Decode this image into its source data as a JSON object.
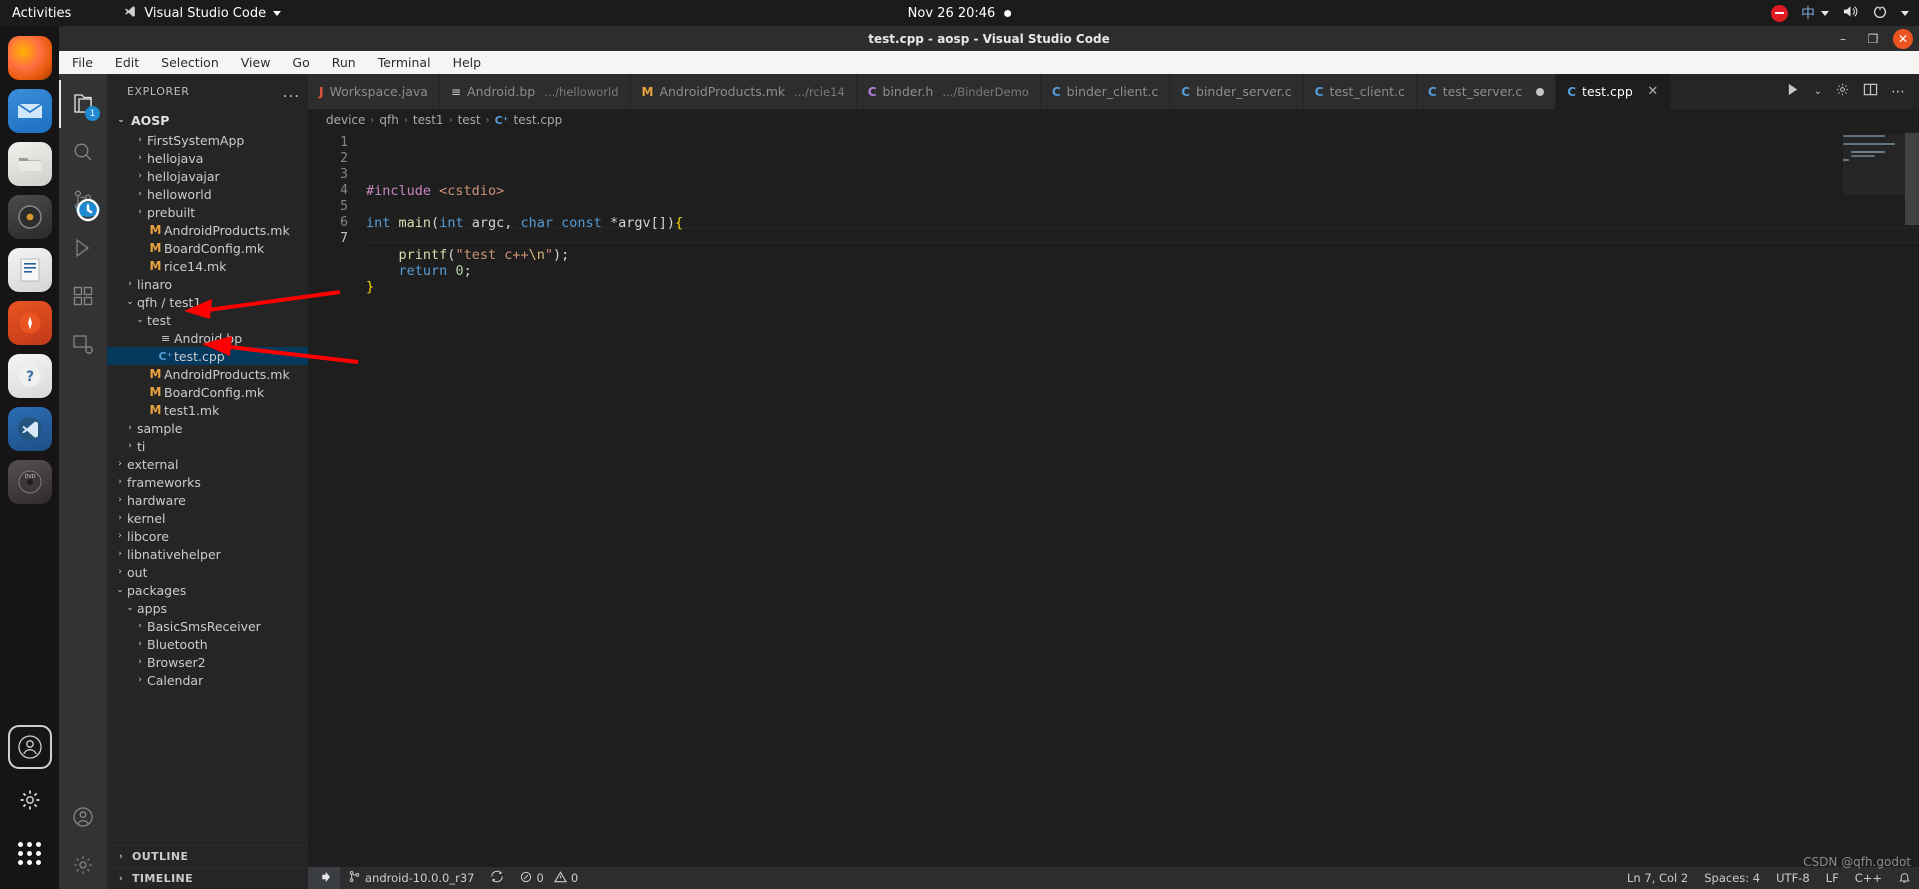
{
  "gnome": {
    "activities": "Activities",
    "app_name": "Visual Studio Code",
    "app_icon": "vscode-icon",
    "clock": "Nov 26  20:46",
    "notification_dot": "notification-dot",
    "record_icon": "record-stop-icon",
    "ime_label": "中",
    "volume_icon": "volume-icon",
    "power_icon": "power-icon"
  },
  "dock": {
    "items": [
      {
        "name": "firefox",
        "glyph": ""
      },
      {
        "name": "thunderbird",
        "glyph": ""
      },
      {
        "name": "files",
        "glyph": ""
      },
      {
        "name": "rhythmbox",
        "glyph": ""
      },
      {
        "name": "libreoffice-writer",
        "glyph": ""
      },
      {
        "name": "ubuntu-software",
        "glyph": ""
      },
      {
        "name": "help",
        "glyph": "?"
      },
      {
        "name": "visual-studio-code",
        "glyph": ""
      },
      {
        "name": "dvd-drive",
        "glyph": "DVD"
      }
    ],
    "bottom": [
      {
        "name": "trash-user",
        "glyph": ""
      },
      {
        "name": "settings",
        "glyph": ""
      },
      {
        "name": "show-applications",
        "glyph": ""
      }
    ]
  },
  "window": {
    "title": "test.cpp - aosp - Visual Studio Code",
    "minimize": "–",
    "maximize": "❐",
    "close": "✕"
  },
  "menubar": {
    "items": [
      "File",
      "Edit",
      "Selection",
      "View",
      "Go",
      "Run",
      "Terminal",
      "Help"
    ]
  },
  "activitybar": {
    "items": [
      {
        "name": "explorer",
        "icon": "files-icon",
        "active": true,
        "badge": "1"
      },
      {
        "name": "search",
        "icon": "search-icon",
        "active": false,
        "badge": ""
      },
      {
        "name": "source-control",
        "icon": "source-control-icon",
        "active": false,
        "badge": "clock"
      },
      {
        "name": "run-and-debug",
        "icon": "run-debug-icon",
        "active": false,
        "badge": ""
      },
      {
        "name": "extensions",
        "icon": "extensions-icon",
        "active": false,
        "badge": ""
      },
      {
        "name": "remote-explorer",
        "icon": "remote-explorer-icon",
        "active": false,
        "badge": ""
      }
    ],
    "bottom": [
      {
        "name": "accounts",
        "icon": "account-icon"
      },
      {
        "name": "manage",
        "icon": "gear-icon"
      }
    ]
  },
  "sidebar": {
    "header": "EXPLORER",
    "actions": "...",
    "root": "AOSP",
    "tree": [
      {
        "label": "FirstSystemApp",
        "indent": 3,
        "type": "folder",
        "expanded": false
      },
      {
        "label": "hellojava",
        "indent": 3,
        "type": "folder",
        "expanded": false
      },
      {
        "label": "hellojavajar",
        "indent": 3,
        "type": "folder",
        "expanded": false
      },
      {
        "label": "helloworld",
        "indent": 3,
        "type": "folder",
        "expanded": false
      },
      {
        "label": "prebuilt",
        "indent": 3,
        "type": "folder",
        "expanded": false
      },
      {
        "label": "AndroidProducts.mk",
        "indent": 3,
        "type": "mk"
      },
      {
        "label": "BoardConfig.mk",
        "indent": 3,
        "type": "mk"
      },
      {
        "label": "rice14.mk",
        "indent": 3,
        "type": "mk"
      },
      {
        "label": "linaro",
        "indent": 2,
        "type": "folder",
        "expanded": false
      },
      {
        "label": "qfh / test1",
        "indent": 2,
        "type": "folder",
        "expanded": true
      },
      {
        "label": "test",
        "indent": 3,
        "type": "folder",
        "expanded": true
      },
      {
        "label": "Android.bp",
        "indent": 4,
        "type": "bp"
      },
      {
        "label": "test.cpp",
        "indent": 4,
        "type": "cpp",
        "selected": true
      },
      {
        "label": "AndroidProducts.mk",
        "indent": 3,
        "type": "mk"
      },
      {
        "label": "BoardConfig.mk",
        "indent": 3,
        "type": "mk"
      },
      {
        "label": "test1.mk",
        "indent": 3,
        "type": "mk"
      },
      {
        "label": "sample",
        "indent": 2,
        "type": "folder",
        "expanded": false
      },
      {
        "label": "ti",
        "indent": 2,
        "type": "folder",
        "expanded": false
      },
      {
        "label": "external",
        "indent": 1,
        "type": "folder",
        "expanded": false
      },
      {
        "label": "frameworks",
        "indent": 1,
        "type": "folder",
        "expanded": false
      },
      {
        "label": "hardware",
        "indent": 1,
        "type": "folder",
        "expanded": false
      },
      {
        "label": "kernel",
        "indent": 1,
        "type": "folder",
        "expanded": false
      },
      {
        "label": "libcore",
        "indent": 1,
        "type": "folder",
        "expanded": false
      },
      {
        "label": "libnativehelper",
        "indent": 1,
        "type": "folder",
        "expanded": false
      },
      {
        "label": "out",
        "indent": 1,
        "type": "folder",
        "expanded": false
      },
      {
        "label": "packages",
        "indent": 1,
        "type": "folder",
        "expanded": true
      },
      {
        "label": "apps",
        "indent": 2,
        "type": "folder",
        "expanded": true
      },
      {
        "label": "BasicSmsReceiver",
        "indent": 3,
        "type": "folder",
        "expanded": false
      },
      {
        "label": "Bluetooth",
        "indent": 3,
        "type": "folder",
        "expanded": false
      },
      {
        "label": "Browser2",
        "indent": 3,
        "type": "folder",
        "expanded": false
      },
      {
        "label": "Calendar",
        "indent": 3,
        "type": "folder",
        "expanded": false
      }
    ],
    "sections": [
      {
        "label": "OUTLINE"
      },
      {
        "label": "TIMELINE"
      }
    ]
  },
  "tabs": [
    {
      "label": "Workspace.java",
      "desc": "",
      "icon": "java",
      "active": false,
      "dirty": false
    },
    {
      "label": "Android.bp",
      "desc": ".../helloworld",
      "icon": "bp",
      "active": false,
      "dirty": false
    },
    {
      "label": "AndroidProducts.mk",
      "desc": ".../rcie14",
      "icon": "mk",
      "active": false,
      "dirty": false
    },
    {
      "label": "binder.h",
      "desc": ".../BinderDemo",
      "icon": "h",
      "active": false,
      "dirty": false
    },
    {
      "label": "binder_client.c",
      "desc": "",
      "icon": "c",
      "active": false,
      "dirty": false
    },
    {
      "label": "binder_server.c",
      "desc": "",
      "icon": "c",
      "active": false,
      "dirty": false
    },
    {
      "label": "test_client.c",
      "desc": "",
      "icon": "c",
      "active": false,
      "dirty": false
    },
    {
      "label": "test_server.c",
      "desc": "",
      "icon": "c",
      "active": false,
      "dirty": true
    },
    {
      "label": "test.cpp",
      "desc": "",
      "icon": "cpp",
      "active": true,
      "dirty": false
    }
  ],
  "tab_actions": [
    {
      "name": "run-or-debug",
      "glyph": "▷"
    },
    {
      "name": "split-editor-right",
      "glyph": "▥"
    },
    {
      "name": "more-actions",
      "glyph": "⋯"
    },
    {
      "name": "toggle-panel",
      "glyph": "▤"
    }
  ],
  "breadcrumb": [
    "device",
    "qfh",
    "test1",
    "test",
    "test.cpp"
  ],
  "editor": {
    "language": "cpp",
    "lines": [
      {
        "n": 1,
        "text": "#include <cstdio>"
      },
      {
        "n": 2,
        "text": ""
      },
      {
        "n": 3,
        "text": "int main(int argc, char const *argv[]){"
      },
      {
        "n": 4,
        "text": ""
      },
      {
        "n": 5,
        "text": "    printf(\"test c++\\n\");"
      },
      {
        "n": 6,
        "text": "    return 0;"
      },
      {
        "n": 7,
        "text": "}"
      }
    ],
    "current_line": 7
  },
  "statusbar": {
    "remote": "android-10.0.0_r37",
    "remote_icon": "remote-indicator-icon",
    "sync_icon": "sync-icon",
    "errors": "0",
    "warnings": "0",
    "error_icon": "error-icon",
    "warning_icon": "warning-icon",
    "position": "Ln 7, Col 2",
    "spaces": "Spaces: 4",
    "encoding": "UTF-8",
    "eol": "LF",
    "language": "C++",
    "feedback_icon": "bell-icon"
  },
  "watermark": "CSDN @qfh.godot",
  "colors": {
    "accent": "#0078d4",
    "selection": "#04395e",
    "sidebar_bg": "#252526",
    "editor_bg": "#1e1e1e",
    "statusbar_bg": "#2d2d2d",
    "annotation_arrow": "#ff0000"
  }
}
